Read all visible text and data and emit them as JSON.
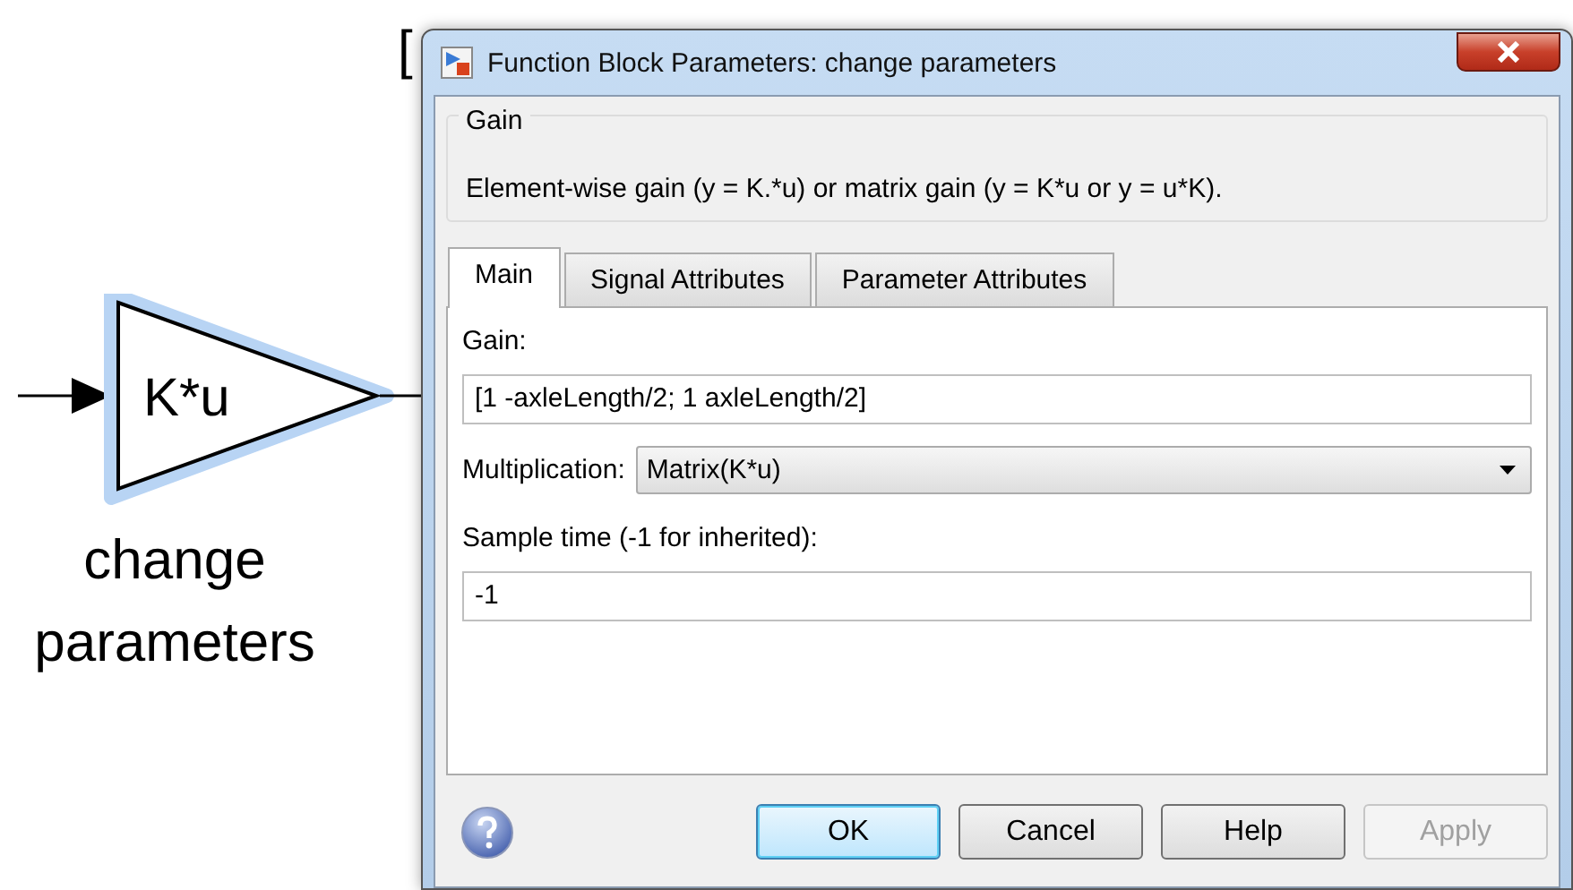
{
  "canvas": {
    "background_text": "[",
    "block": {
      "expression": "K*u",
      "label": "change parameters",
      "selected": true
    }
  },
  "dialog": {
    "title": "Function Block Parameters: change parameters",
    "group": {
      "legend": "Gain",
      "description": "Element-wise gain (y = K.*u) or matrix gain (y = K*u or y = u*K)."
    },
    "tabs": [
      {
        "label": "Main",
        "selected": true
      },
      {
        "label": "Signal Attributes",
        "selected": false
      },
      {
        "label": "Parameter Attributes",
        "selected": false
      }
    ],
    "fields": [
      {
        "kind": "text",
        "label": "Gain:",
        "value": "[1 -axleLength/2; 1 axleLength/2]"
      },
      {
        "kind": "dropdown",
        "label": "Multiplication:",
        "value": "Matrix(K*u)"
      },
      {
        "kind": "text",
        "label": "Sample time (-1 for inherited):",
        "value": "-1"
      }
    ],
    "buttons": [
      {
        "label": "OK",
        "default": true,
        "disabled": false
      },
      {
        "label": "Cancel",
        "default": false,
        "disabled": false
      },
      {
        "label": "Help",
        "default": false,
        "disabled": false
      },
      {
        "label": "Apply",
        "default": false,
        "disabled": true
      }
    ]
  }
}
